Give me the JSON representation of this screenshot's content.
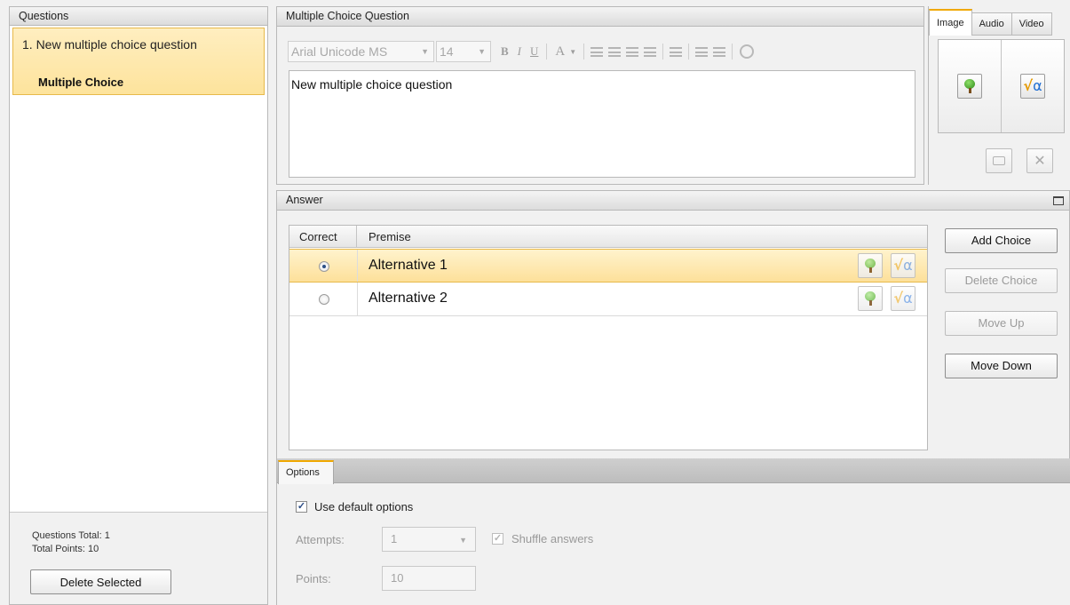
{
  "questions_panel": {
    "header": "Questions",
    "items": [
      {
        "number_title": "1.  New multiple choice question",
        "type": "Multiple Choice"
      }
    ],
    "stats": {
      "total": "Questions Total: 1",
      "points": "Total Points: 10"
    },
    "delete_button": "Delete Selected"
  },
  "question_editor": {
    "header": "Multiple Choice Question",
    "toolbar": {
      "font_family": "Arial Unicode MS",
      "font_size": "14",
      "bold": "B",
      "italic": "I",
      "underline": "U",
      "font_color": "A"
    },
    "text": "New multiple choice question"
  },
  "media_panel": {
    "tabs": [
      "Image",
      "Audio",
      "Video"
    ],
    "active_tab": "Image"
  },
  "answer_panel": {
    "header": "Answer",
    "columns": {
      "correct": "Correct",
      "premise": "Premise"
    },
    "rows": [
      {
        "premise": "Alternative 1",
        "correct": true
      },
      {
        "premise": "Alternative 2",
        "correct": false
      }
    ],
    "buttons": {
      "add": "Add Choice",
      "delete": "Delete Choice",
      "up": "Move Up",
      "down": "Move Down"
    }
  },
  "options_panel": {
    "tab": "Options",
    "use_default_label": "Use default options",
    "attempts_label": "Attempts:",
    "attempts_value": "1",
    "shuffle_label": "Shuffle answers",
    "points_label": "Points:",
    "points_value": "10"
  },
  "colors": {
    "accent": "#f0a800",
    "selection": "#fde39c"
  },
  "icons": [
    "insert-image-icon",
    "insert-formula-icon",
    "folder-icon",
    "delete-x-icon",
    "maximize-icon",
    "radio-icon",
    "checkbox-icon"
  ]
}
